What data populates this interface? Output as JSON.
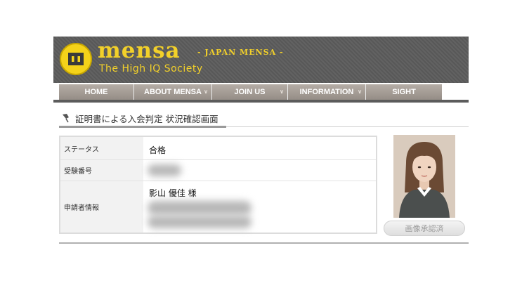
{
  "header": {
    "brand_name": "mensa",
    "brand_sub": "- JAPAN MENSA -",
    "tagline": "The High IQ Society",
    "logo_icon": "mensa-logo-icon",
    "colors": {
      "header_bg": "#5c5c5c",
      "brand_gold": "#f2d02a"
    }
  },
  "nav": {
    "items": [
      {
        "label": "HOME"
      },
      {
        "label": "ABOUT MENSA"
      },
      {
        "label": "JOIN US"
      },
      {
        "label": "INFORMATION"
      },
      {
        "label": "SIGHT"
      }
    ]
  },
  "page": {
    "title": "証明書による入会判定 状況確認画面",
    "title_icon": "pin-icon"
  },
  "info": {
    "status_label": "ステータス",
    "status_value": "合格",
    "exam_no_label": "受験番号",
    "applicant_label": "申請者情報",
    "applicant_name": "影山 優佳 様"
  },
  "photo_panel": {
    "approve_label": "画像承認済"
  }
}
